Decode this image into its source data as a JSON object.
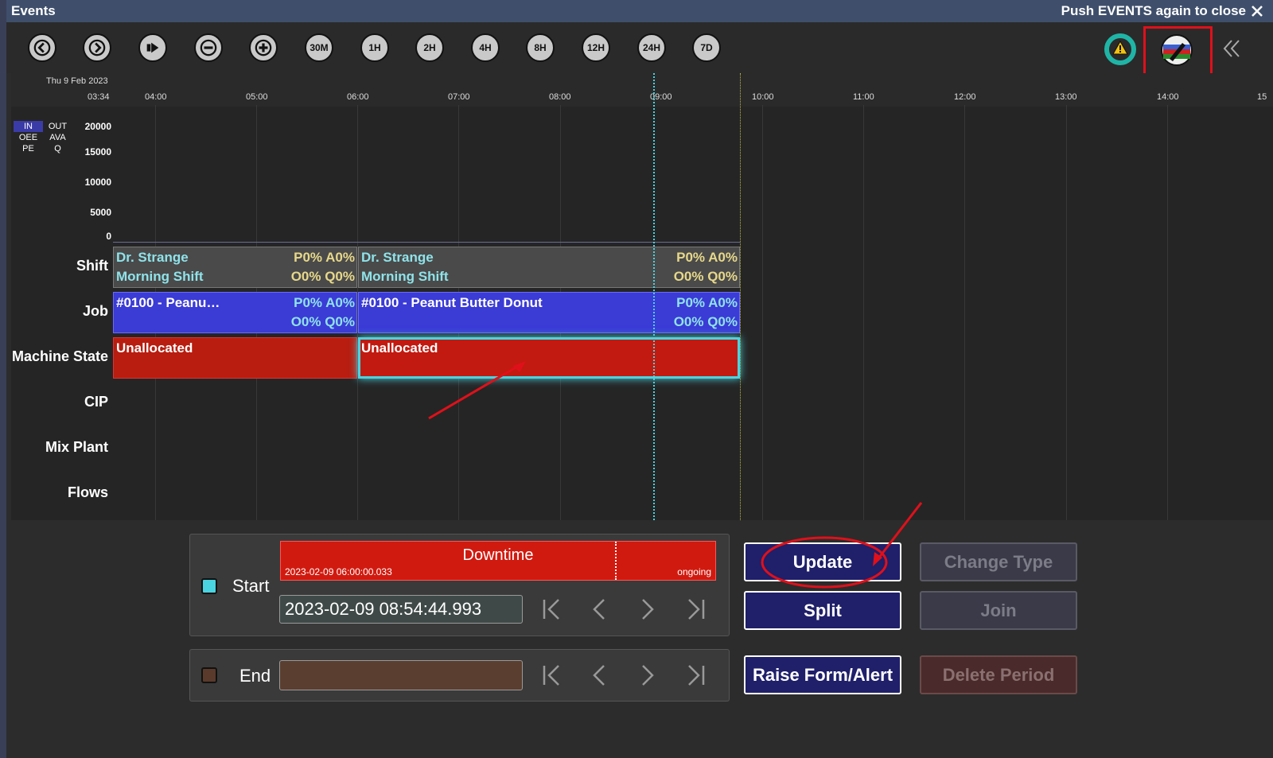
{
  "window": {
    "title": "Events",
    "close_hint": "Push EVENTS again to close"
  },
  "toolbar": {
    "buttons": [
      "30M",
      "1H",
      "2H",
      "4H",
      "8H",
      "12H",
      "24H",
      "7D"
    ]
  },
  "timeline": {
    "date": "Thu 9 Feb 2023",
    "start_time": "03:34",
    "ticks": [
      "04:00",
      "05:00",
      "06:00",
      "07:00",
      "08:00",
      "09:00",
      "10:00",
      "11:00",
      "12:00",
      "13:00",
      "14:00",
      "15"
    ],
    "metric_tabs": [
      "IN",
      "OUT",
      "OEE",
      "AVA",
      "PE",
      "Q"
    ],
    "y_axis": [
      "20000",
      "15000",
      "10000",
      "5000",
      "0"
    ],
    "rows": [
      "Shift",
      "Job",
      "Machine State",
      "CIP",
      "Mix Plant",
      "Flows"
    ],
    "shift": [
      {
        "line1": "Dr. Strange",
        "line2": "Morning Shift",
        "pa": "P0% A0%",
        "oq": "O0% Q0%"
      },
      {
        "line1": "Dr. Strange",
        "line2": "Morning Shift",
        "pa": "P0% A0%",
        "oq": "O0% Q0%"
      }
    ],
    "job": [
      {
        "label": "#0100 - Peanu…",
        "pa": "P0% A0%",
        "oq": "O0% Q0%"
      },
      {
        "label": "#0100 - Peanut Butter Donut",
        "pa": "P0% A0%",
        "oq": "O0% Q0%"
      }
    ],
    "machine_state": [
      {
        "label": "Unallocated"
      },
      {
        "label": "Unallocated"
      }
    ]
  },
  "editor": {
    "start_label": "Start",
    "end_label": "End",
    "event_type": "Downtime",
    "event_start": "2023-02-09 06:00:00.033",
    "event_end": "ongoing",
    "start_value": "2023-02-09 08:54:44.993",
    "end_value": ""
  },
  "actions": {
    "update": "Update",
    "split": "Split",
    "raise": "Raise Form/Alert",
    "change_type": "Change Type",
    "join": "Join",
    "delete": "Delete Period"
  },
  "colors": {
    "shift": "#4a4a4a",
    "job": "#3b3bd6",
    "machine": "#c21a10",
    "now_line": "#4ad3e0",
    "accent_text": "#8fe3ea"
  }
}
